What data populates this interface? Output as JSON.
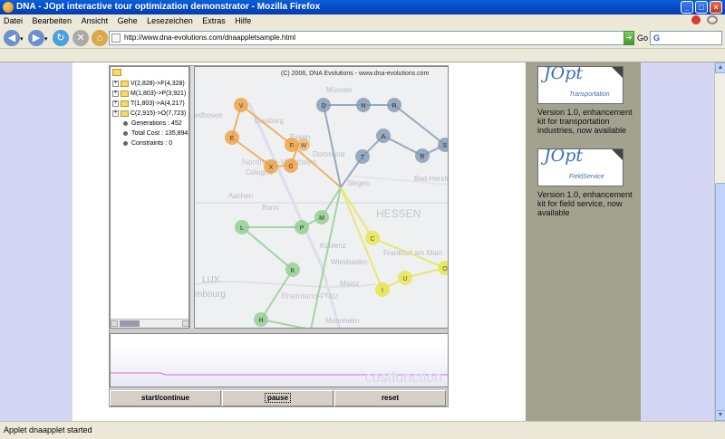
{
  "window": {
    "title": "DNA - JOpt interactive tour optimization demonstrator - Mozilla Firefox"
  },
  "menu": [
    "Datei",
    "Bearbeiten",
    "Ansicht",
    "Gehe",
    "Lesezeichen",
    "Extras",
    "Hilfe"
  ],
  "address": {
    "url": "http://www.dna-evolutions.com/dnaappletsample.html",
    "go_label": "Go",
    "search_label": "G"
  },
  "status": {
    "text": "Applet dnaapplet started"
  },
  "tree": {
    "rows": [
      {
        "kind": "route",
        "label": "V(2,828)->F(4,328)"
      },
      {
        "kind": "route",
        "label": "M(1,803)->P(3,921)"
      },
      {
        "kind": "route",
        "label": "T(1,803)->A(4,217)"
      },
      {
        "kind": "route",
        "label": "C(2,915)->O(7,723)"
      },
      {
        "kind": "info",
        "label": "Generations : 452"
      },
      {
        "kind": "info",
        "label": "Total Cost : 135,894"
      },
      {
        "kind": "info",
        "label": "Constraints : 0"
      }
    ]
  },
  "map": {
    "copyright": "(C) 2006, DNA Evolutions - www.dna-evolutions.com",
    "place_labels": [
      "Münster",
      "Duisburg",
      "Essen",
      "Dortmund",
      "Nordrhein-Westfalen",
      "Cologne",
      "Aachen",
      "Bonn",
      "Siegen",
      "Bad Hersfeld",
      "HESSEN",
      "Koblenz",
      "Wiesbaden",
      "Frankfurt am Main",
      "Mainz",
      "Rheinland-Pfalz",
      "Mannheim",
      "LUX.",
      "mbourg",
      "edhoven"
    ],
    "colors": {
      "orange": "#f0a040",
      "blue": "#7f9ab0",
      "green": "#8fce8f",
      "yellow": "#e6e650"
    }
  },
  "cost": {
    "label": "costfunction"
  },
  "controls": {
    "start": "start/continue",
    "pause": "pause",
    "reset": "reset"
  },
  "sidebar": {
    "promos": [
      {
        "logo": "JOpt",
        "logo_sub": "Transportation",
        "text": "Version 1.0, enhancement kit for transportation industries, now available"
      },
      {
        "logo": "JOpt",
        "logo_sub": "FieldService",
        "text": "Version 1.0, enhancement kit for field service, now available"
      }
    ]
  }
}
